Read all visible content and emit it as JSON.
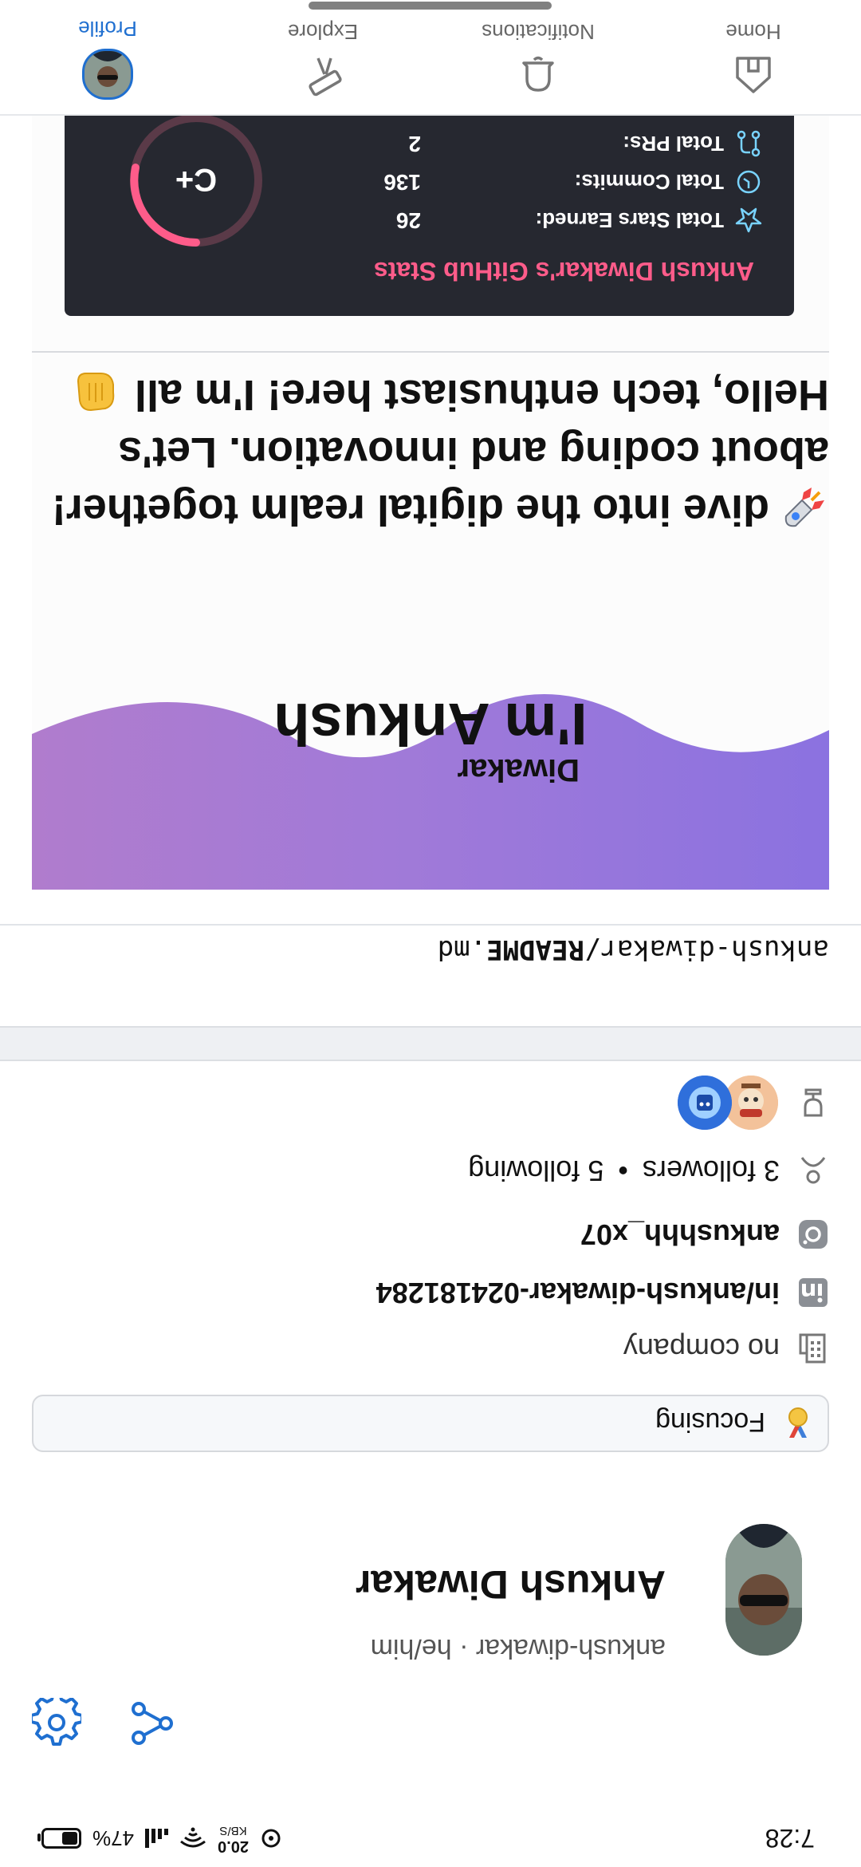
{
  "status_bar": {
    "time": "7:28",
    "net_speed": "20.0",
    "net_unit": "KB/S",
    "battery": "47%",
    "battery_level": 0.47
  },
  "profile": {
    "name": "Ankush Diwakar",
    "handle": "ankush-diwakar · he/him",
    "status": "Focusing",
    "company": "no company",
    "linkedin": "in/ankush-diwakar-024181284",
    "instagram": "ankushhh_x07",
    "followers": "3 followers",
    "following": "5 following",
    "separator": "•"
  },
  "readme": {
    "path_prefix": "ankush-diwakar/",
    "path_file": "README",
    "path_ext": ".md",
    "banner_title": "I'm Ankush",
    "banner_subtitle": "Diwakar",
    "intro_lines": [
      "Hello, tech enthusiast here! I'm all",
      "about coding and innovation. Let's",
      "dive into the digital realm together!"
    ]
  },
  "github_stats": {
    "title": "Ankush Diwakar's GitHub Stats",
    "rows": [
      {
        "label": "Total Stars Earned:",
        "value": "26"
      },
      {
        "label": "Total Commits:",
        "value": "136"
      },
      {
        "label": "Total PRs:",
        "value": "2"
      }
    ],
    "grade": "C+",
    "accent": "#fe5c8a",
    "icon_color": "#79ff97"
  },
  "bottom_nav": {
    "items": [
      {
        "label": "Home",
        "icon": "home-icon"
      },
      {
        "label": "Notifications",
        "icon": "bell-icon"
      },
      {
        "label": "Explore",
        "icon": "telescope-icon"
      },
      {
        "label": "Profile",
        "icon": "avatar"
      }
    ],
    "active": "Profile",
    "active_color": "#1f6fd0"
  },
  "icons": {
    "share": "share-icon",
    "settings": "gear-icon",
    "achievements": "trophy-icon",
    "people": "people-icon",
    "instagram": "instagram-icon",
    "linkedin": "linkedin-icon",
    "company": "building-icon",
    "status": "medal-icon"
  }
}
